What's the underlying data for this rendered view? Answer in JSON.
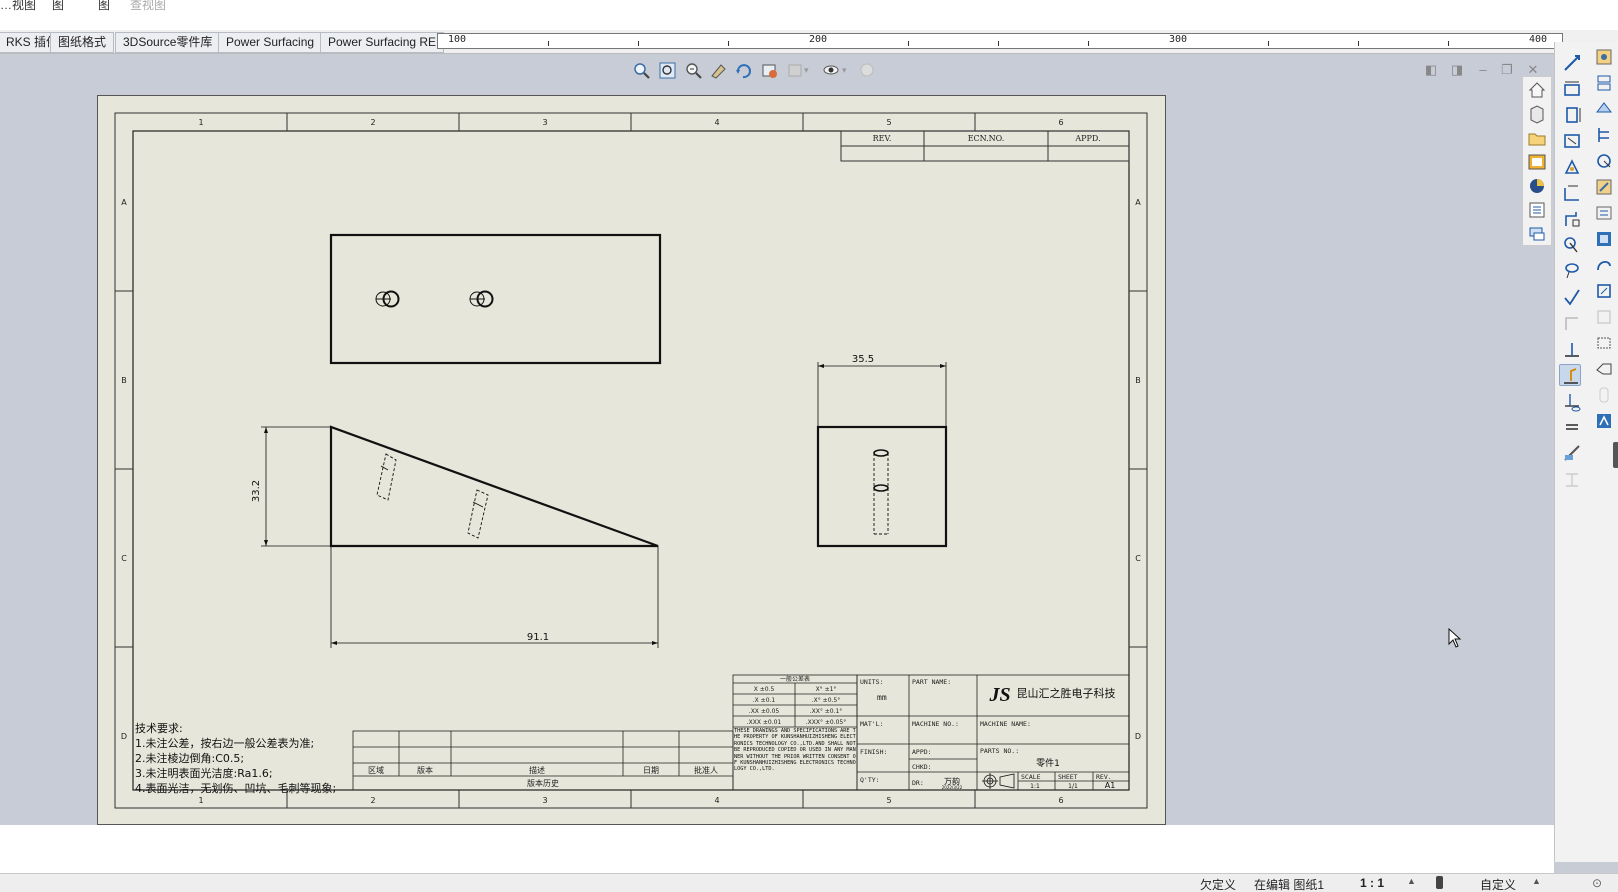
{
  "menu": [
    "…视图",
    "图",
    "图",
    "查视图"
  ],
  "tabs": [
    "RKS 插件",
    "图纸格式",
    "3DSource零件库",
    "Power Surfacing",
    "Power Surfacing RE"
  ],
  "ruler": {
    "labels": [
      "100",
      "200",
      "300",
      "400"
    ]
  },
  "view_toolbar": {
    "icons": [
      "zoom-to-fit-icon",
      "zoom-to-area-icon",
      "zoom-in-out-icon",
      "pan-icon",
      "rotate-icon",
      "view-orientation-icon",
      "display-style-icon",
      "hide-show-icon",
      "appearance-icon"
    ]
  },
  "drawing": {
    "zone_columns": [
      "1",
      "2",
      "3",
      "4",
      "5",
      "6"
    ],
    "zone_rows": [
      "A",
      "B",
      "C",
      "D"
    ],
    "revision_header": [
      "REV.",
      "ECN.NO.",
      "APPD."
    ],
    "dim_width": "35.5",
    "dim_height": "33.2",
    "dim_length": "91.1",
    "tech_requirements": {
      "title": "技术要求:",
      "lines": [
        "1.未注公差，按右边一般公差表为准;",
        "2.未注棱边倒角:C0.5;",
        "3.未注明表面光洁度:Ra1.6;",
        "4.表面光洁，无划伤、凹坑、毛刺等现象;"
      ]
    },
    "revision_table": {
      "headers": [
        "区域",
        "版本",
        "描述",
        "日期",
        "批准人"
      ],
      "footer": "版本历史"
    },
    "tolerance_table": {
      "title": "一般公差表",
      "rows": [
        [
          "X   ±0.5",
          "X°   ±1°"
        ],
        [
          ".X   ±0.1",
          ".X°   ±0.5°"
        ],
        [
          ".XX   ±0.05",
          ".XX°   ±0.1°"
        ],
        [
          ".XXX   ±0.01",
          ".XXX°   ±0.05°"
        ]
      ],
      "notice": "THESE DRAWINGS AND SPECIFICATIONS ARE THE PROPERTY OF KUNSHANHUIZHISHENG ELECTRONICS TECHNOLOGY CO.,LTD.AND SHALL NOT BE REPRODUCED COPIED OR USED IN ANY MANNER WITHOUT THE PRIOR WRITTEN CONSENT OF KUNSHANHUIZHISHENG ELECTRONICS TECHNOLOGY CO.,LTD."
    },
    "title_block": {
      "units_label": "UNITS:",
      "units_value": "mm",
      "part_name_label": "PART NAME:",
      "matl_label": "MAT'L:",
      "machine_no_label": "MACHINE NO.:",
      "machine_name_label": "MACHINE NAME:",
      "finish_label": "FINISH:",
      "appd_label": "APPD:",
      "chkd_label": "CHKD:",
      "parts_no_label": "PARTS NO.:",
      "parts_no_value": "零件1",
      "qty_label": "Q'TY:",
      "dr_label": "DR:",
      "dr_value": "万韵",
      "date_value": "2022/3/22",
      "company": "昆山汇之胜电子科技",
      "logo_text": "JS",
      "scale_label": "SCALE",
      "scale_value": "1:1",
      "sheet_label": "SHEET",
      "sheet_value": "1/1",
      "rev_label": "REV.",
      "rev_value": "A1"
    }
  },
  "status_bar": {
    "definition": "欠定义",
    "editing": "在编辑 图纸1",
    "scale": "1 : 1",
    "custom": "自定义"
  },
  "colors": {
    "sheet_bg": "#e6e6da",
    "graphics_bg": "#c7ccd6",
    "line": "#111111"
  }
}
